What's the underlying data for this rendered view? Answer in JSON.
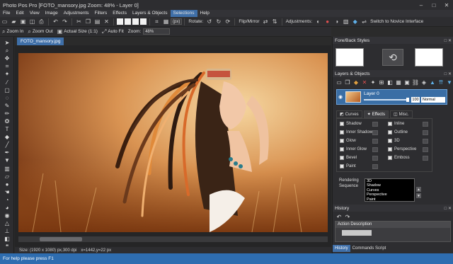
{
  "window": {
    "title": "Photo Pos Pro [FOTO_mansory.jpg Zoom: 48% - Layer 0]",
    "minimize": "–",
    "maximize": "□",
    "close": "✕"
  },
  "menu": [
    "File",
    "Edit",
    "View",
    "Image",
    "Adjustments",
    "Filters",
    "Effects",
    "Layers & Objects",
    "Selections",
    "Help"
  ],
  "toolbar": {
    "px_unit": "(px)",
    "rotate_label": "Rotate:",
    "flip_label": "Flip/Mirror",
    "adjustments_label": "Adjustments:",
    "novice_label": "Switch to Novice Interface"
  },
  "toolbar2": {
    "zoom_in": "Zoom In",
    "zoom_out": "Zoom Out",
    "actual_size": "Actual Size (1:1)",
    "auto_fit": "Auto Fit",
    "zoom_label": "Zoom:",
    "zoom_value": "48%"
  },
  "tab": {
    "label": "FOTO_mansory.jpg"
  },
  "status_info": {
    "size": "Size: (1920 x 1080) px,300 dpi",
    "coords": "x=1442,y=22 px"
  },
  "status_bar": {
    "text": "For help please press F1"
  },
  "panels": {
    "fore_back": {
      "title": "Fore/Back Styles",
      "controls": "□ ✕"
    },
    "layers": {
      "title": "Layers & Objects",
      "controls": "□ ✕",
      "layer_name": "Layer 0",
      "opacity": "100",
      "blend": "Normal"
    },
    "effects_tabs": [
      "Curves",
      "Effects",
      "Misc."
    ],
    "effects": {
      "left": [
        "Shadow",
        "Inner Shadow",
        "Glow",
        "Inner Glow",
        "Bevel",
        "Paint"
      ],
      "right": [
        "Inline",
        "Outline",
        "3D",
        "Perspective",
        "Emboss"
      ]
    },
    "rendering": {
      "label_line1": "Rendering",
      "label_line2": "Sequence",
      "items": [
        "3D",
        "Shadow",
        "Curves",
        "Perspective",
        "Paint"
      ]
    },
    "history": {
      "title": "History",
      "controls": "□ ✕",
      "header": "Action Description"
    },
    "bottom_tabs": [
      "History",
      "Commands Script"
    ]
  },
  "colors": {
    "accent": "#3f6fa8",
    "status": "#2e6db0",
    "panel_bg": "#2d2d30"
  }
}
